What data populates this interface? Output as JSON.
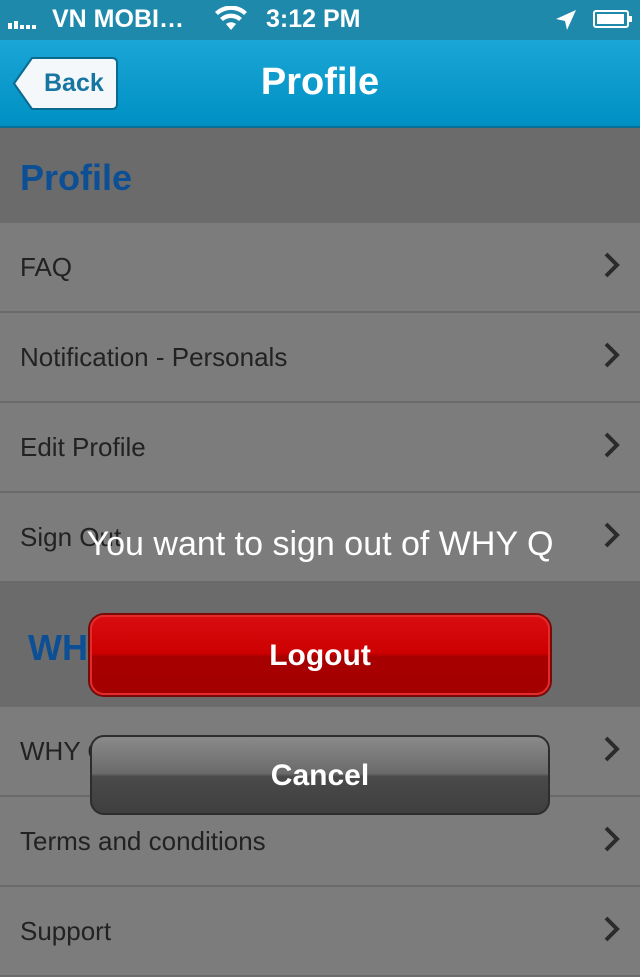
{
  "status_bar": {
    "carrier": "VN MOBI…",
    "time": "3:12 PM"
  },
  "nav": {
    "back_label": "Back",
    "title": "Profile"
  },
  "sections": [
    {
      "header": "Profile",
      "items": [
        "FAQ",
        "Notification - Personals",
        "Edit Profile",
        "Sign Out"
      ]
    },
    {
      "header": "WHY Q",
      "items": [
        "WHY Q",
        "Terms and conditions",
        "Support"
      ]
    }
  ],
  "dialog": {
    "message": "You want to sign out of WHY Q",
    "confirm_label": "Logout",
    "cancel_label": "Cancel"
  },
  "icons": {
    "signal": "signal-bars-icon",
    "wifi": "wifi-icon",
    "location": "location-arrow-icon",
    "battery": "battery-icon",
    "chevron": "chevron-right-icon"
  },
  "colors": {
    "nav_bar": "#0aa0d0",
    "section_header_text": "#0c4f94",
    "logout": "#cc0000"
  }
}
